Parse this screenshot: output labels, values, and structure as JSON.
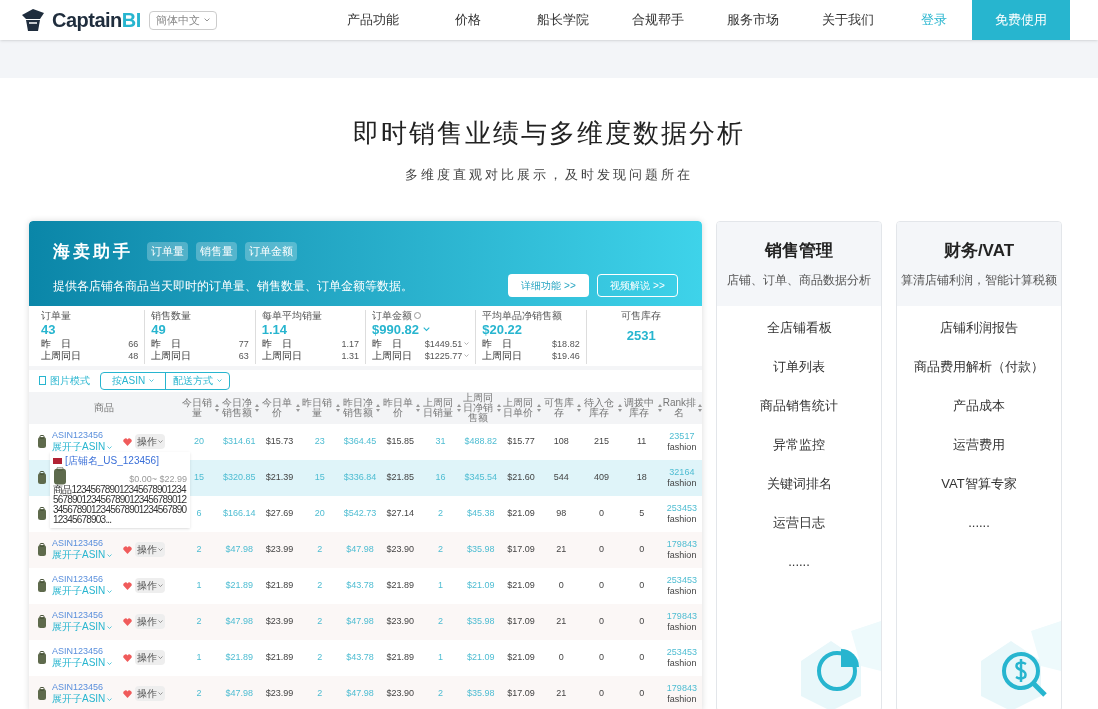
{
  "header": {
    "logo": {
      "main": "Captain",
      "accent": "BI"
    },
    "language": "簡体中文",
    "nav": [
      {
        "label": "产品功能",
        "selected": false
      },
      {
        "label": "价格",
        "selected": false
      },
      {
        "label": "船长学院",
        "selected": false
      },
      {
        "label": "合规帮手",
        "selected": false
      },
      {
        "label": "服务市场",
        "selected": false
      },
      {
        "label": "关于我们",
        "selected": false
      }
    ],
    "login": "登录",
    "cta": "免费使用"
  },
  "hero": {
    "title": "即时销售业绩与多维度数据分析",
    "subtitle": "多维度直观对比展示，及时发现问题所在"
  },
  "panel": {
    "banner": {
      "title": "海卖助手",
      "tags": [
        "订单量",
        "销售量",
        "订单金额"
      ],
      "description": "提供各店铺各商品当天即时的订单量、销售数量、订单金额等数据。",
      "buttons": [
        {
          "label": "详细功能 >>",
          "kind": "solid"
        },
        {
          "label": "视频解说 >>",
          "kind": "outline"
        }
      ]
    },
    "stats": [
      {
        "label": "订单量",
        "value": "43",
        "info": false,
        "dropdown": false,
        "rows": [
          {
            "label": "昨　日",
            "value": "66"
          },
          {
            "label": "上周同日",
            "value": "48"
          }
        ]
      },
      {
        "label": "销售数量",
        "value": "49",
        "info": false,
        "dropdown": false,
        "rows": [
          {
            "label": "昨　日",
            "value": "77"
          },
          {
            "label": "上周同日",
            "value": "63"
          }
        ]
      },
      {
        "label": "每单平均销量",
        "value": "1.14",
        "info": false,
        "dropdown": false,
        "rows": [
          {
            "label": "昨　日",
            "value": "1.17"
          },
          {
            "label": "上周同日",
            "value": "1.31"
          }
        ]
      },
      {
        "label": "订单金额",
        "value": "$990.82",
        "info": true,
        "dropdown": true,
        "rows": [
          {
            "label": "昨　日",
            "value": "$1449.51"
          },
          {
            "label": "上周同日",
            "value": "$1225.77"
          }
        ]
      },
      {
        "label": "平均单品净销售额",
        "value": "$20.22",
        "info": false,
        "dropdown": false,
        "rows": [
          {
            "label": "昨　日",
            "value": "$18.82"
          },
          {
            "label": "上周同日",
            "value": "$19.46"
          }
        ]
      },
      {
        "label": "可售库存",
        "value": "2531",
        "info": false,
        "dropdown": false
      }
    ],
    "toolbar": {
      "mode": "图片模式",
      "selects": [
        "按ASIN",
        "配送方式"
      ]
    },
    "table": {
      "product_header": "商品",
      "columns": [
        {
          "label": "今日销量",
          "kind": "count"
        },
        {
          "label": "今日净销售额",
          "kind": "amount"
        },
        {
          "label": "今日单价",
          "kind": "price"
        },
        {
          "label": "昨日销量",
          "kind": "count"
        },
        {
          "label": "昨日净销售额",
          "kind": "amount"
        },
        {
          "label": "昨日单价",
          "kind": "price"
        },
        {
          "label": "上周同日销量",
          "kind": "count"
        },
        {
          "label": "上周同日净销售额",
          "kind": "amount"
        },
        {
          "label": "上周同日单价",
          "kind": "price"
        },
        {
          "label": "可售库存",
          "kind": "stock"
        },
        {
          "label": "待入仓库存",
          "kind": "stock"
        },
        {
          "label": "调拨中库存",
          "kind": "stock"
        }
      ],
      "rank_header": "Rank排名",
      "rows": [
        {
          "selected": false,
          "asin": "ASIN123456",
          "expand": "展开子ASIN",
          "action": "操作",
          "cells": [
            "20",
            "$314.61",
            "$15.73",
            "23",
            "$364.45",
            "$15.85",
            "31",
            "$488.82",
            "$15.77",
            "108",
            "215",
            "11"
          ],
          "rank": "23517",
          "category": "fashion"
        },
        {
          "selected": true,
          "cells": [
            "15",
            "$320.85",
            "$21.39",
            "15",
            "$336.84",
            "$21.85",
            "16",
            "$345.54",
            "$21.60",
            "544",
            "409",
            "18"
          ],
          "rank": "32164",
          "category": "fashion"
        },
        {
          "selected": false,
          "cells": [
            "6",
            "$166.14",
            "$27.69",
            "20",
            "$542.73",
            "$27.14",
            "2",
            "$45.38",
            "$21.09",
            "98",
            "0",
            "5"
          ],
          "rank": "253453",
          "category": "fashion"
        },
        {
          "selected": false,
          "asin": "ASIN123456",
          "expand": "展开子ASIN",
          "action": "操作",
          "cells": [
            "2",
            "$47.98",
            "$23.99",
            "2",
            "$47.98",
            "$23.90",
            "2",
            "$35.98",
            "$17.09",
            "21",
            "0",
            "0"
          ],
          "rank": "179843",
          "category": "fashion"
        },
        {
          "selected": false,
          "asin": "ASIN123456",
          "expand": "展开子ASIN",
          "action": "操作",
          "cells": [
            "1",
            "$21.89",
            "$21.89",
            "2",
            "$43.78",
            "$21.89",
            "1",
            "$21.09",
            "$21.09",
            "0",
            "0",
            "0"
          ],
          "rank": "253453",
          "category": "fashion"
        },
        {
          "selected": false,
          "asin": "ASIN123456",
          "expand": "展开子ASIN",
          "action": "操作",
          "cells": [
            "2",
            "$47.98",
            "$23.99",
            "2",
            "$47.98",
            "$23.90",
            "2",
            "$35.98",
            "$17.09",
            "21",
            "0",
            "0"
          ],
          "rank": "179843",
          "category": "fashion"
        },
        {
          "selected": false,
          "asin": "ASIN123456",
          "expand": "展开子ASIN",
          "action": "操作",
          "cells": [
            "1",
            "$21.89",
            "$21.89",
            "2",
            "$43.78",
            "$21.89",
            "1",
            "$21.09",
            "$21.09",
            "0",
            "0",
            "0"
          ],
          "rank": "253453",
          "category": "fashion"
        },
        {
          "selected": false,
          "asin": "ASIN123456",
          "expand": "展开子ASIN",
          "action": "操作",
          "cells": [
            "2",
            "$47.98",
            "$23.99",
            "2",
            "$47.98",
            "$23.90",
            "2",
            "$35.98",
            "$17.09",
            "21",
            "0",
            "0"
          ],
          "rank": "179843",
          "category": "fashion"
        }
      ]
    },
    "tooltip": {
      "store": "[店铺名_US_123456]",
      "title": "商品1234567890123456789012345678901234567890123456789012345678901234567890123456789012345678903...",
      "price": "$0.00~ $22.99"
    }
  },
  "cards": [
    {
      "title": "销售管理",
      "subtitle": "店铺、订单、商品数据分析",
      "items": [
        "全店铺看板",
        "订单列表",
        "商品销售统计",
        "异常监控",
        "关键词排名",
        "运营日志",
        "......"
      ]
    },
    {
      "title": "财务/VAT",
      "subtitle": "算清店铺利润，智能计算税额",
      "items": [
        "店铺利润报告",
        "商品费用解析（付款）",
        "产品成本",
        "运营费用",
        "VAT智算专家",
        "......"
      ]
    }
  ]
}
